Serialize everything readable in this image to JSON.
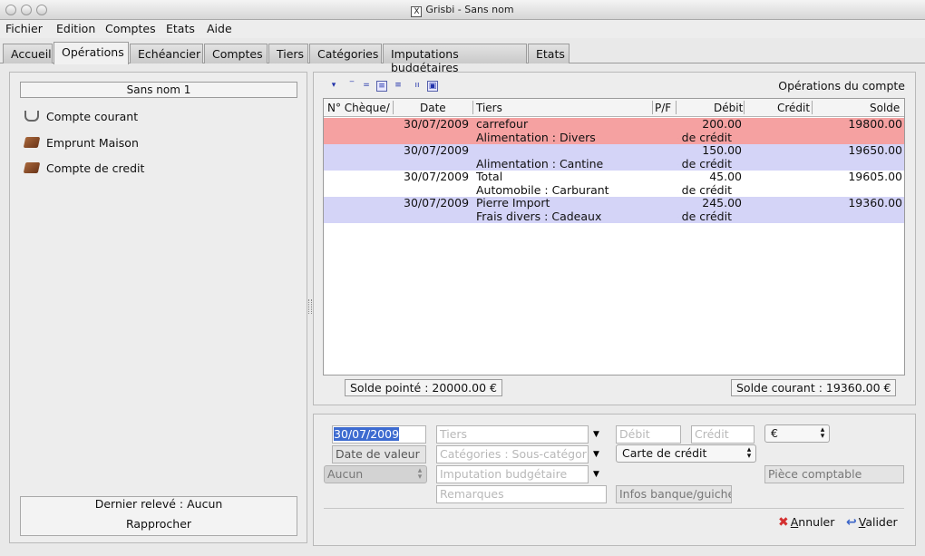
{
  "window": {
    "title": "Grisbi - Sans nom"
  },
  "menu": [
    "Fichier",
    "Edition",
    "Comptes",
    "Etats",
    "Aide"
  ],
  "tabs": [
    {
      "label": "Accueil",
      "active": false
    },
    {
      "label": "Opérations",
      "active": true
    },
    {
      "label": "Echéancier",
      "active": false
    },
    {
      "label": "Comptes",
      "active": false
    },
    {
      "label": "Tiers",
      "active": false
    },
    {
      "label": "Catégories",
      "active": false
    },
    {
      "label": "Imputations budgétaires",
      "active": false
    },
    {
      "label": "Etats",
      "active": false
    }
  ],
  "sidebar": {
    "file_name": "Sans nom 1",
    "accounts": [
      {
        "label": "Compte courant",
        "icon": "open-book-icon"
      },
      {
        "label": "Emprunt Maison",
        "icon": "book-icon"
      },
      {
        "label": "Compte de credit",
        "icon": "book-icon"
      }
    ],
    "last_statement": "Dernier relevé : Aucun",
    "reconcile_label": "Rapprocher"
  },
  "operations": {
    "title": "Opérations du compte",
    "columns": [
      "N° Chèque/",
      "Date",
      "Tiers",
      "P/F",
      "Débit",
      "Crédit",
      "Solde"
    ],
    "transactions": [
      {
        "color": "pink",
        "cheque": "",
        "date": "30/07/2009",
        "tiers": "carrefour",
        "category": "Alimentation : Divers",
        "payment": "Carte de crédit",
        "debit": "200.00",
        "credit": "",
        "solde": "19800.00"
      },
      {
        "color": "lav",
        "cheque": "",
        "date": "30/07/2009",
        "tiers": "",
        "category": "Alimentation : Cantine",
        "payment": "Carte de crédit",
        "debit": "150.00",
        "credit": "",
        "solde": "19650.00"
      },
      {
        "color": "white",
        "cheque": "",
        "date": "30/07/2009",
        "tiers": "Total",
        "category": "Automobile : Carburant",
        "payment": "Carte de crédit",
        "debit": "45.00",
        "credit": "",
        "solde": "19605.00"
      },
      {
        "color": "lav",
        "cheque": "",
        "date": "30/07/2009",
        "tiers": "Pierre Import",
        "category": "Frais divers : Cadeaux",
        "payment": "Carte de crédit",
        "debit": "245.00",
        "credit": "",
        "solde": "19360.00"
      }
    ],
    "solde_pointe": "Solde pointé : 20000.00 €",
    "solde_courant": "Solde courant : 19360.00 €"
  },
  "form": {
    "date": "30/07/2009",
    "tiers_placeholder": "Tiers",
    "debit_placeholder": "Débit",
    "credit_placeholder": "Crédit",
    "currency": "€",
    "value_date_placeholder": "Date de valeur",
    "categories_placeholder": "Catégories : Sous-catégories",
    "payment_method": "Carte de crédit",
    "aucun": "Aucun",
    "imputation_placeholder": "Imputation budgétaire",
    "piece_placeholder": "Pièce comptable",
    "remarques_placeholder": "Remarques",
    "infos_placeholder": "Infos banque/guichet",
    "cancel_label": "Annuler",
    "cancel_accel": "A",
    "validate_label": "Valider",
    "validate_accel": "V"
  },
  "colors": {
    "pink_row": "#f5a1a1",
    "lavender_row": "#d4d4f7",
    "selected_date": "#3d6bd0"
  }
}
